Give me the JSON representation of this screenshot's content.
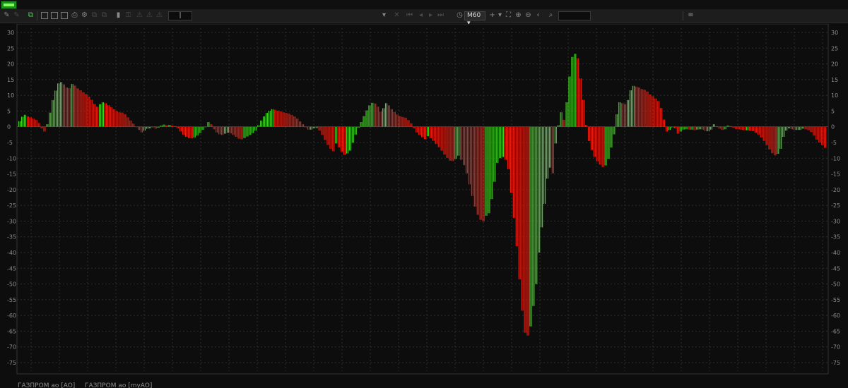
{
  "toolbar": {
    "interval": "M60"
  },
  "legend": {
    "items": [
      "ГАЗПРОМ ао [AO]",
      "ГАЗПРОМ ао [myAO]"
    ]
  },
  "colors": {
    "background": "#0d0d0d",
    "grid": "#2e2e2e",
    "axis_text": "#8f8f8f",
    "up": "#3ecf1f",
    "down": "#ea1c0e"
  },
  "icons": [
    "pencil-icon",
    "indicator-icon",
    "window-icon",
    "table-icon",
    "print-icon",
    "message-icon",
    "cross-icon",
    "crosshair-icon",
    "fit-screen-icon",
    "zoom-in-icon",
    "zoom-out-icon",
    "back-icon",
    "search-icon",
    "menu-icon"
  ],
  "chart_data": {
    "type": "bar",
    "ylim": [
      -75,
      30
    ],
    "yticks": [
      30,
      25,
      20,
      15,
      10,
      5,
      0,
      -5,
      -10,
      -15,
      -20,
      -25,
      -30,
      -35,
      -40,
      -45,
      -50,
      -55,
      -60,
      -65,
      -70,
      -75
    ],
    "grid": true,
    "bars_per_column": 2,
    "color_rule": "green when value rises vs previous bar, red when it falls",
    "series": [
      {
        "values": [
          1.8,
          3.2,
          3.8,
          3.3,
          3.0,
          2.6,
          2.2,
          1.2,
          -0.5,
          -1.5,
          0.8,
          4.5,
          8.5,
          11.5,
          13.8,
          14.2,
          13.5,
          12.5,
          12.3,
          13.6,
          13.1,
          12.2,
          11.6,
          11.0,
          10.4,
          9.6,
          8.6,
          7.3,
          6.4,
          7.2,
          7.8,
          7.5,
          6.9,
          6.3,
          5.6,
          5.0,
          4.6,
          4.5,
          4.0,
          3.0,
          2.0,
          1.0,
          0.0,
          -1.0,
          -1.8,
          -1.2,
          -0.6,
          -0.5,
          0.0,
          -0.6,
          -0.3,
          0.4,
          0.7,
          0.5,
          0.6,
          0.4,
          0.2,
          -0.5,
          -1.5,
          -2.5,
          -3.2,
          -3.6,
          -3.7,
          -3.4,
          -2.8,
          -2.0,
          -1.0,
          0.0,
          1.5,
          0.8,
          -0.8,
          -1.8,
          -2.4,
          -2.6,
          -2.2,
          -1.9,
          -2.1,
          -2.6,
          -3.2,
          -3.8,
          -4.0,
          -3.6,
          -3.1,
          -2.6,
          -2.0,
          -1.2,
          0.5,
          2.0,
          3.3,
          4.4,
          5.1,
          5.6,
          5.4,
          5.1,
          4.9,
          4.6,
          4.4,
          4.2,
          3.8,
          3.3,
          2.6,
          1.7,
          0.8,
          -0.2,
          -0.9,
          -0.9,
          -0.5,
          -0.4,
          -1.2,
          -2.6,
          -4.2,
          -5.8,
          -7.0,
          -7.8,
          -5.3,
          -6.5,
          -7.9,
          -8.9,
          -8.5,
          -7.6,
          -5.1,
          -2.5,
          -0.3,
          1.5,
          3.4,
          5.2,
          6.8,
          7.6,
          7.4,
          6.4,
          4.8,
          5.9,
          7.5,
          6.8,
          5.6,
          4.7,
          3.9,
          3.4,
          3.1,
          2.9,
          2.1,
          1.1,
          -0.5,
          -1.8,
          -2.6,
          -3.3,
          -3.9,
          -3.0,
          -3.6,
          -4.5,
          -5.5,
          -6.5,
          -7.6,
          -8.8,
          -9.9,
          -10.8,
          -10.9,
          -10.2,
          -9.2,
          -10.5,
          -12.2,
          -14.8,
          -18.3,
          -22.0,
          -25.4,
          -28.0,
          -29.6,
          -30.1,
          -28.3,
          -27.5,
          -23.0,
          -17.5,
          -11.5,
          -10.0,
          -9.6,
          -10.5,
          -13.5,
          -21.0,
          -29.0,
          -38.0,
          -48.5,
          -58.5,
          -65.5,
          -66.4,
          -63.5,
          -57.0,
          -50.0,
          -40.0,
          -32.0,
          -24.5,
          -16.5,
          -13.0,
          -14.8,
          -5.3,
          0.5,
          4.6,
          2.2,
          7.8,
          16.0,
          22.2,
          23.2,
          21.8,
          15.4,
          8.6,
          0.6,
          -4.5,
          -7.4,
          -9.6,
          -11.0,
          -12.0,
          -12.8,
          -12.3,
          -10.2,
          -6.6,
          -2.4,
          4.0,
          7.8,
          7.5,
          7.2,
          8.5,
          11.6,
          13.0,
          12.8,
          12.5,
          12.0,
          11.8,
          11.2,
          10.3,
          9.7,
          9.0,
          8.2,
          6.0,
          2.3,
          -1.5,
          -1.0,
          -0.2,
          -0.5,
          -2.2,
          -1.5,
          -0.9,
          -0.8,
          -0.9,
          -0.9,
          -1.1,
          -0.9,
          -0.8,
          -0.9,
          -1.4,
          -1.4,
          -0.9,
          0.8,
          0.2,
          -0.6,
          -1.0,
          -0.8,
          0.4,
          0.2,
          -0.3,
          -0.7,
          -0.8,
          -1.0,
          -1.1,
          -1.1,
          -1.2,
          -1.4,
          -1.9,
          -2.5,
          -3.4,
          -4.5,
          -5.8,
          -7.2,
          -8.4,
          -9.1,
          -8.6,
          -7.0,
          -3.2,
          -1.2,
          -0.5,
          -0.8,
          -1.0,
          -1.0,
          -1.0,
          -0.6,
          -0.8,
          -1.1,
          -1.7,
          -2.8,
          -4.1,
          -5.0,
          -5.8,
          -6.7
        ]
      }
    ]
  }
}
